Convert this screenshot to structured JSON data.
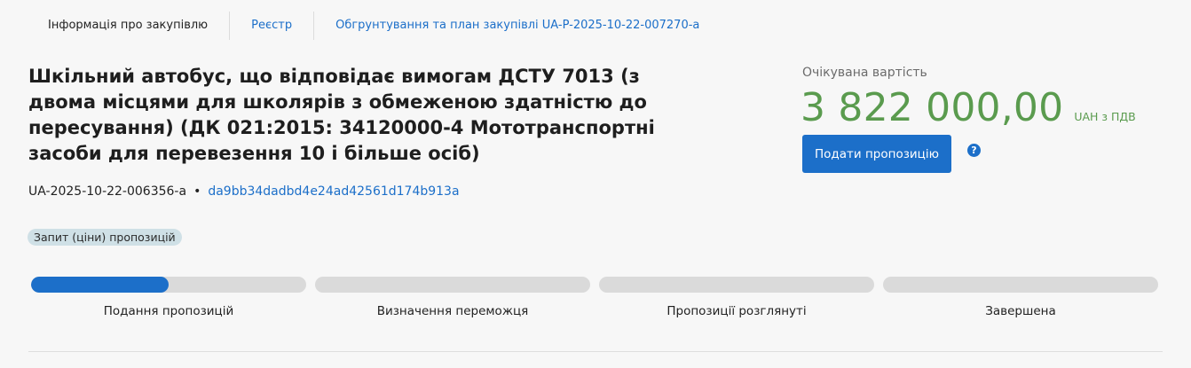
{
  "tabs": [
    {
      "label": "Інформація про закупівлю"
    },
    {
      "label": "Реєстр"
    },
    {
      "label": "Обгрунтування та план закупівлі UA-P-2025-10-22-007270-a"
    }
  ],
  "tender": {
    "title": "Шкільний автобус, що відповідає вимогам ДСТУ 7013 (з двома місцями для школярів з обмеженою здатністю до пересування) (ДК 021:2015: 34120000-4 Мототранспортні засоби для перевезення 10 і більше осіб)",
    "id": "UA-2025-10-22-006356-a",
    "separator": "•",
    "hash": "da9bb34dadbd4e24ad42561d174b913a",
    "procedure_type": "Запит (ціни) пропозицій"
  },
  "price": {
    "label": "Очікувана вартість",
    "amount": "3 822 000,00",
    "currency": "UAH з ПДВ"
  },
  "actions": {
    "submit_label": "Подати пропозицію",
    "help_icon": "?"
  },
  "progress": {
    "steps": [
      {
        "label": "Подання пропозицій",
        "progress": 0.5
      },
      {
        "label": "Визначення переможця",
        "progress": 0
      },
      {
        "label": "Пропозиції розглянуті",
        "progress": 0
      },
      {
        "label": "Завершена",
        "progress": 0
      }
    ]
  },
  "colors": {
    "accent": "#1c6fc9",
    "price": "#5a9b4e",
    "badge_bg": "#cfe0e6"
  }
}
